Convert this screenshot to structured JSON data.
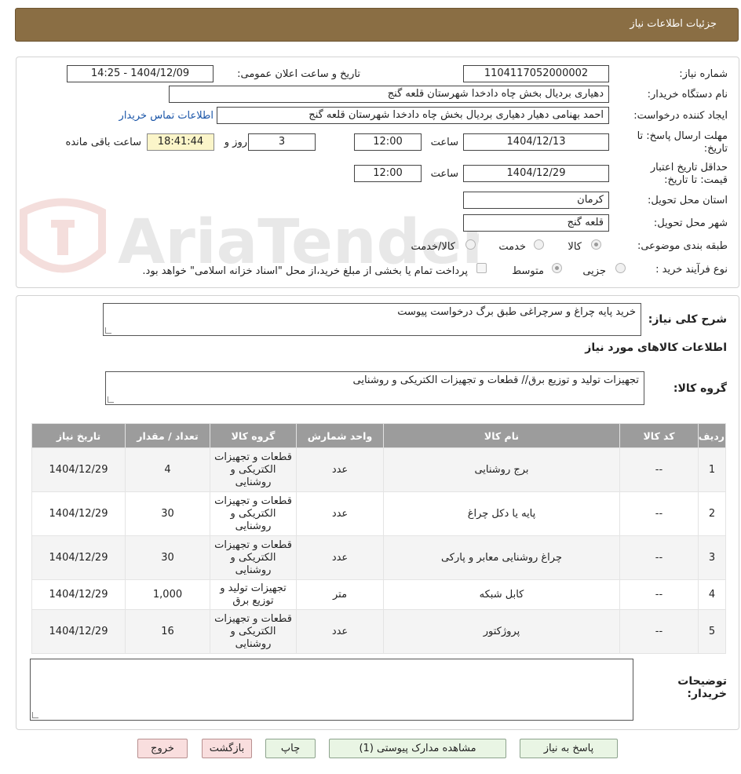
{
  "header": {
    "title": "جزئیات اطلاعات نیاز"
  },
  "form": {
    "need_number_label": "شماره نیاز:",
    "need_number": "1104117052000002",
    "announce_label": "تاریخ و ساعت اعلان عمومی:",
    "announce_value": "1404/12/09 - 14:25",
    "buyer_org_label": "نام دستگاه خریدار:",
    "buyer_org": "دهیاری بردیال بخش چاه دادخدا شهرستان قلعه گنج",
    "creator_label": "ایجاد کننده درخواست:",
    "creator": "احمد بهنامی دهیار دهیاری بردیال بخش چاه دادخدا شهرستان قلعه گنج",
    "contact_link": "اطلاعات تماس خریدار",
    "reply_deadline_label": "مهلت ارسال پاسخ: تا تاریخ:",
    "reply_date": "1404/12/13",
    "time_label": "ساعت",
    "reply_time": "12:00",
    "days_value": "3",
    "days_label": "روز و",
    "remaining_time": "18:41:44",
    "remaining_label": "ساعت باقی مانده",
    "price_validity_label": "حداقل تاریخ اعتبار قیمت: تا تاریخ:",
    "price_date": "1404/12/29",
    "price_time": "12:00",
    "province_label": "استان محل تحویل:",
    "province": "کرمان",
    "city_label": "شهر محل تحویل:",
    "city": "قلعه گنج",
    "category_label": "طبقه بندی موضوعی:",
    "category_goods": "کالا",
    "category_service": "خدمت",
    "category_both": "کالا/خدمت",
    "process_label": "نوع فرآیند خرید :",
    "process_partial": "جزیی",
    "process_medium": "متوسط",
    "payment_note": "پرداخت تمام یا بخشی از مبلغ خرید،از محل \"اسناد خزانه اسلامی\" خواهد بود."
  },
  "summary": {
    "label": "شرح کلی نیاز:",
    "text": "خرید پایه چراغ و سرچراغی  طبق برگ درخواست پیوست",
    "goods_info_title": "اطلاعات کالاهای مورد نیاز",
    "group_label": "گروه کالا:",
    "group_text": "تجهیزات تولید و توزیع برق// قطعات و تجهیزات الکتریکی و روشنایی"
  },
  "table": {
    "headers": [
      "ردیف",
      "کد کالا",
      "نام کالا",
      "واحد شمارش",
      "گروه کالا",
      "تعداد / مقدار",
      "تاریخ نیاز"
    ],
    "rows": [
      {
        "row": "1",
        "code": "--",
        "name": "برج روشنایی",
        "unit": "عدد",
        "group": "قطعات و تجهیزات الکتریکی و روشنایی",
        "qty": "4",
        "date": "1404/12/29"
      },
      {
        "row": "2",
        "code": "--",
        "name": "پایه یا دکل چراغ",
        "unit": "عدد",
        "group": "قطعات و تجهیزات الکتریکی و روشنایی",
        "qty": "30",
        "date": "1404/12/29"
      },
      {
        "row": "3",
        "code": "--",
        "name": "چراغ روشنایی معابر و پارکی",
        "unit": "عدد",
        "group": "قطعات و تجهیزات الکتریکی و روشنایی",
        "qty": "30",
        "date": "1404/12/29"
      },
      {
        "row": "4",
        "code": "--",
        "name": "کابل شبکه",
        "unit": "متر",
        "group": "تجهیزات تولید و توزیع برق",
        "qty": "1,000",
        "date": "1404/12/29"
      },
      {
        "row": "5",
        "code": "--",
        "name": "پروژکتور",
        "unit": "عدد",
        "group": "قطعات و تجهیزات الکتریکی و روشنایی",
        "qty": "16",
        "date": "1404/12/29"
      }
    ]
  },
  "notes": {
    "label": "توضیحات خریدار:",
    "text": ""
  },
  "buttons": {
    "reply": "پاسخ به نیاز",
    "docs": "مشاهده مدارک پیوستی (1)",
    "print": "چاپ",
    "back": "بازگشت",
    "exit": "خروج"
  },
  "watermark": {
    "text": "AriaTender.neT"
  },
  "colors": {
    "header": "#8a6e44",
    "table_header": "#9c9c9c",
    "button_green": "#e9f5e4",
    "button_red": "#f9dede",
    "link": "#1a55a8"
  }
}
